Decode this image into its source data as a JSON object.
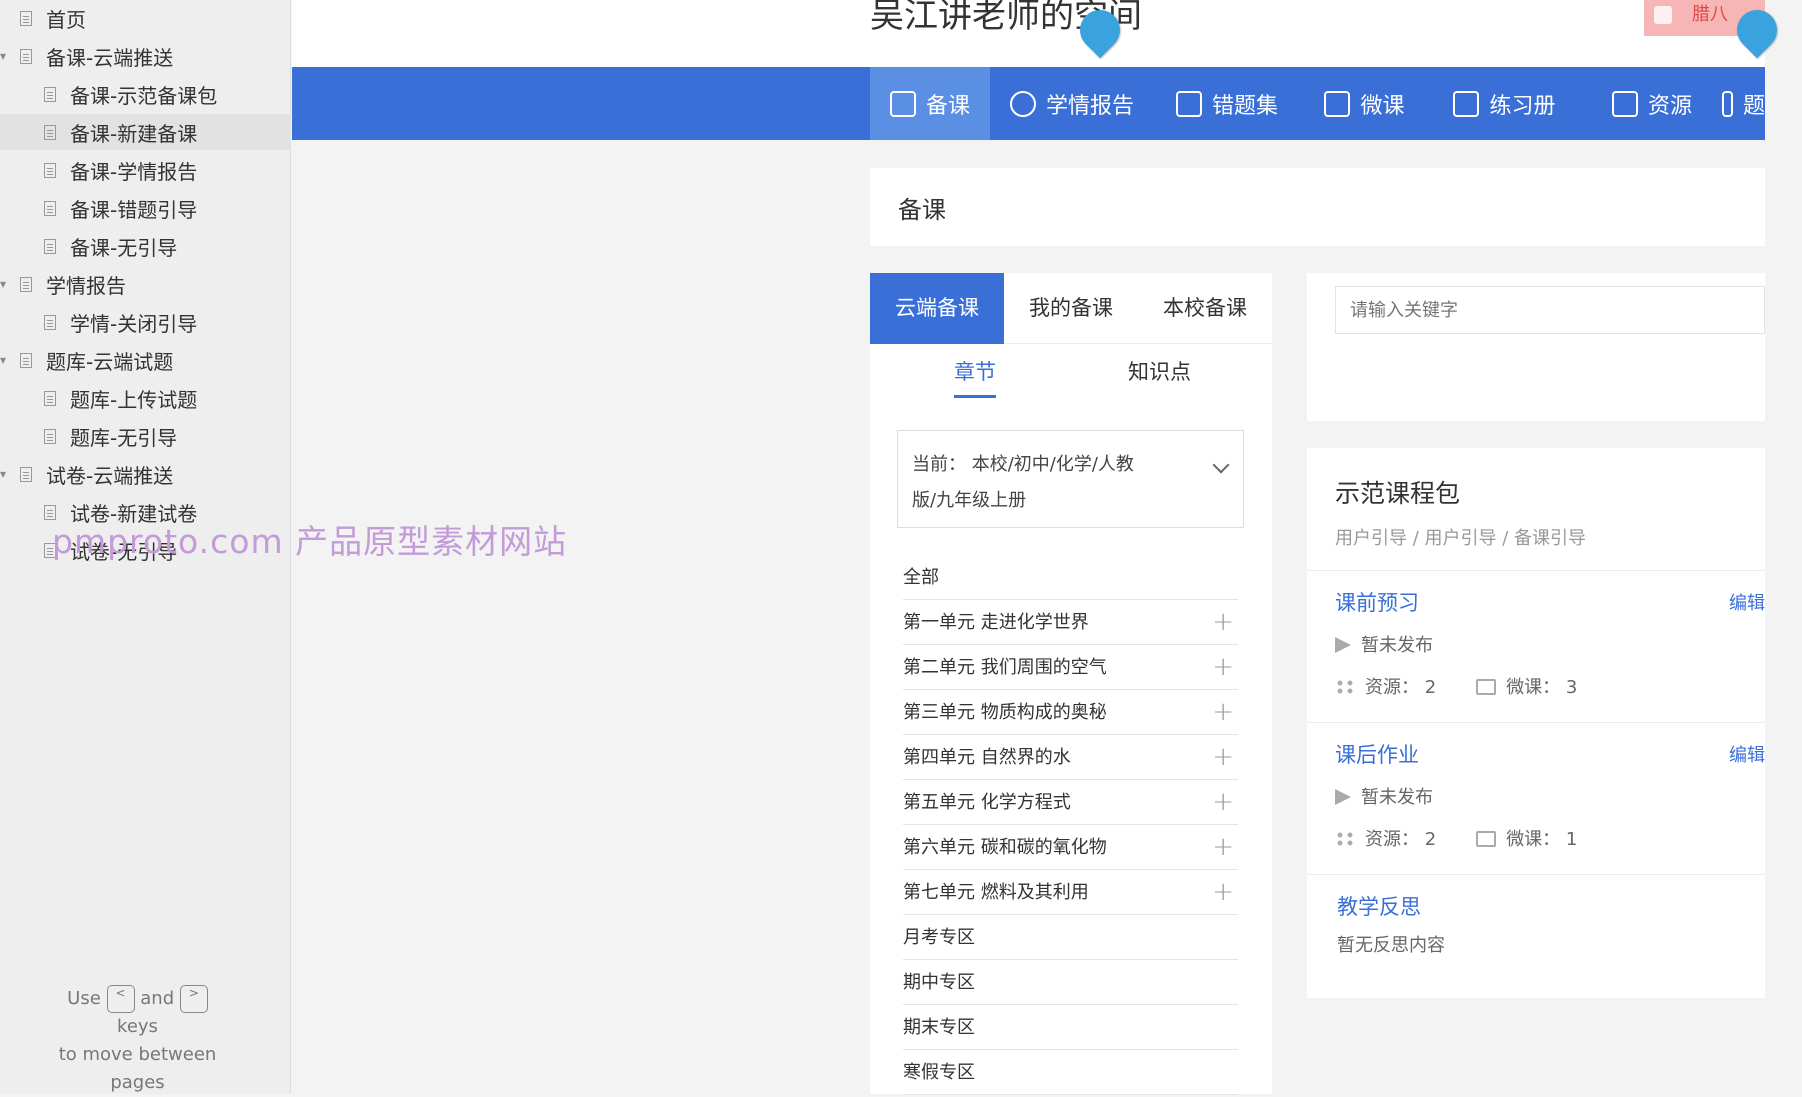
{
  "sidebar": {
    "items": [
      {
        "label": "首页",
        "level": 0,
        "expandable": false
      },
      {
        "label": "备课-云端推送",
        "level": 0,
        "expandable": true
      },
      {
        "label": "备课-示范备课包",
        "level": 1,
        "expandable": false
      },
      {
        "label": "备课-新建备课",
        "level": 1,
        "expandable": false,
        "active": true
      },
      {
        "label": "备课-学情报告",
        "level": 1,
        "expandable": false
      },
      {
        "label": "备课-错题引导",
        "level": 1,
        "expandable": false
      },
      {
        "label": "备课-无引导",
        "level": 1,
        "expandable": false
      },
      {
        "label": "学情报告",
        "level": 0,
        "expandable": true
      },
      {
        "label": "学情-关闭引导",
        "level": 1,
        "expandable": false
      },
      {
        "label": "题库-云端试题",
        "level": 0,
        "expandable": true
      },
      {
        "label": "题库-上传试题",
        "level": 1,
        "expandable": false
      },
      {
        "label": "题库-无引导",
        "level": 1,
        "expandable": false
      },
      {
        "label": "试卷-云端推送",
        "level": 0,
        "expandable": true
      },
      {
        "label": "试卷-新建试卷",
        "level": 1,
        "expandable": false
      },
      {
        "label": "试卷-无引导",
        "level": 1,
        "expandable": false
      }
    ],
    "hint": {
      "use": "Use",
      "prev_key": "<",
      "and": "and",
      "next_key": ">",
      "keys": "keys",
      "line2": "to move between",
      "line3": "pages"
    },
    "watermark": "pmproto.com 产品原型素材网站"
  },
  "header": {
    "site_title": "吴江讲老师的空间",
    "notice_text": "腊八",
    "nav": [
      {
        "label": "备课",
        "icon": "lesson-doc-icon",
        "active": true
      },
      {
        "label": "学情报告",
        "icon": "pie-chart-icon"
      },
      {
        "label": "错题集",
        "icon": "book-icon"
      },
      {
        "label": "微课",
        "icon": "video-camera-icon"
      },
      {
        "label": "练习册",
        "icon": "notebook-icon"
      },
      {
        "label": "资源",
        "icon": "briefcase-icon"
      },
      {
        "label": "题",
        "icon": "clipboard-icon"
      }
    ]
  },
  "page": {
    "title": "备课"
  },
  "left_panel": {
    "tabs": [
      "云端备课",
      "我的备课",
      "本校备课"
    ],
    "active_tab": "云端备课",
    "subtabs": [
      "章节",
      "知识点"
    ],
    "active_subtab": "章节",
    "selector": {
      "line1": "当前： 本校/初中/化学/人教",
      "line2": "版/九年级上册"
    },
    "all_label": "全部",
    "chapters": [
      {
        "label": "第一单元  走进化学世界",
        "expandable": true
      },
      {
        "label": "第二单元  我们周围的空气",
        "expandable": true
      },
      {
        "label": "第三单元  物质构成的奥秘",
        "expandable": true
      },
      {
        "label": "第四单元  自然界的水",
        "expandable": true
      },
      {
        "label": "第五单元  化学方程式",
        "expandable": true
      },
      {
        "label": "第六单元  碳和碳的氧化物",
        "expandable": true
      },
      {
        "label": "第七单元  燃料及其利用",
        "expandable": true
      },
      {
        "label": "月考专区",
        "expandable": false
      },
      {
        "label": "期中专区",
        "expandable": false
      },
      {
        "label": "期末专区",
        "expandable": false
      },
      {
        "label": "寒假专区",
        "expandable": false
      }
    ],
    "plus_glyph": "+"
  },
  "search": {
    "placeholder": "请输入关键字"
  },
  "package": {
    "title": "示范课程包",
    "path": "用户引导 / 用户引导 / 备课引导",
    "sections": [
      {
        "title": "课前预习",
        "edit": "编辑",
        "status": "暂未发布",
        "resources": "资源：  2",
        "micro": "微课：  3"
      },
      {
        "title": "课后作业",
        "edit": "编辑",
        "status": "暂未发布",
        "resources": "资源：  2",
        "micro": "微课：  1"
      }
    ],
    "reflection": {
      "title": "教学反思",
      "text": "暂无反思内容"
    }
  },
  "colors": {
    "primary": "#3a6fd8",
    "nav_active": "#5b8fe4",
    "pin": "#3aa3de",
    "notice": "#f6b6b6"
  }
}
